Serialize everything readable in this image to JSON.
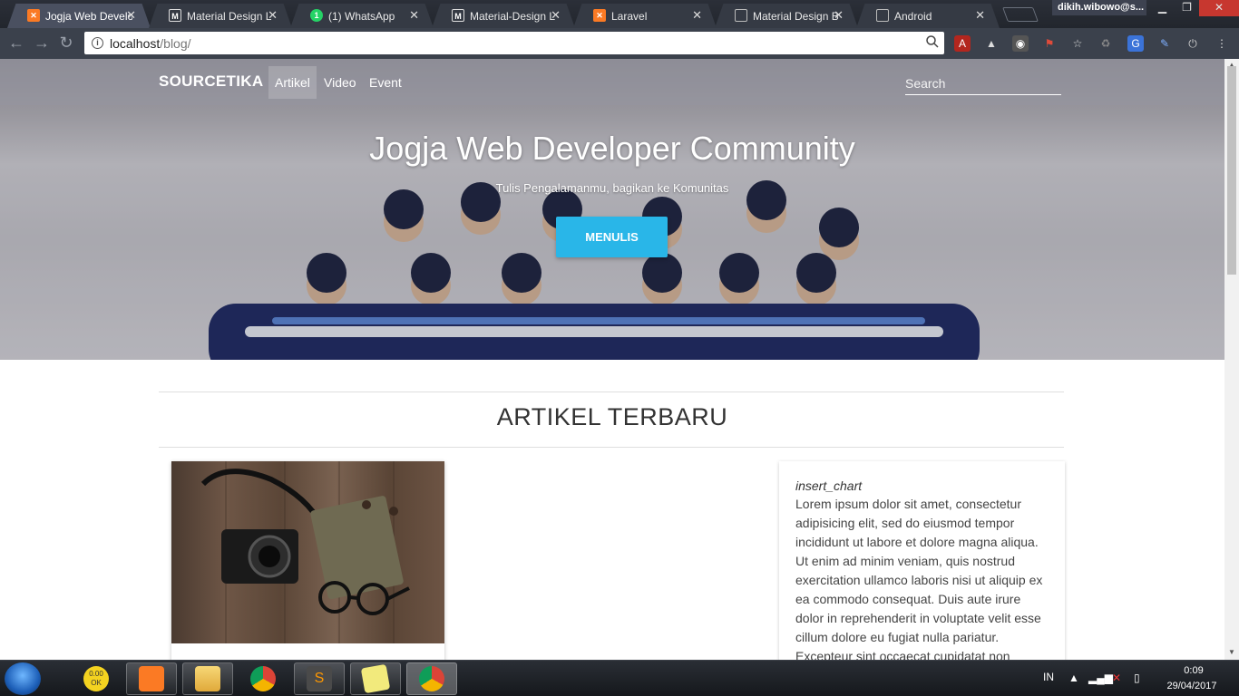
{
  "browser": {
    "tabs": [
      {
        "label": "Jogja Web Develo",
        "favicon": "xampp-icon",
        "fav_color": "#fb7a24"
      },
      {
        "label": "Material Design L",
        "favicon": "material-icon",
        "fav_color": "#3c4048"
      },
      {
        "label": "(1) WhatsApp",
        "favicon": "whatsapp-icon",
        "fav_color": "#25d366"
      },
      {
        "label": "Material-Design L",
        "favicon": "material-icon",
        "fav_color": "#3c4048"
      },
      {
        "label": "Laravel",
        "favicon": "xampp-icon",
        "fav_color": "#fb7a24"
      },
      {
        "label": "Material Design B",
        "favicon": "page-icon",
        "fav_color": "#3c4048"
      },
      {
        "label": "Android",
        "favicon": "page-icon",
        "fav_color": "#3c4048"
      }
    ],
    "profile_name": "dikih.wibowo@s...",
    "url_host": "localhost",
    "url_path": "/blog/"
  },
  "site": {
    "brand": "SOURCETIKA",
    "nav": [
      "Artikel",
      "Video",
      "Event"
    ],
    "search_placeholder": "Search",
    "hero_title": "Jogja Web Developer Community",
    "hero_subtitle": "Tulis Pengalamanmu, bagikan ke Komunitas",
    "cta_label": "MENULIS",
    "section_title": "ARTIKEL TERBARU",
    "sidebar": {
      "icon_text": "insert_chart",
      "body": "Lorem ipsum dolor sit amet, consectetur adipisicing elit, sed do eiusmod tempor incididunt ut labore et dolore magna aliqua. Ut enim ad minim veniam, quis nostrud exercitation ullamco laboris nisi ut aliquip ex ea commodo consequat. Duis aute irure dolor in reprehenderit in voluptate velit esse cillum dolore eu fugiat nulla pariatur. Excepteur sint occaecat cupidatat non"
    },
    "colors": {
      "accent": "#29b6e8"
    }
  },
  "taskbar": {
    "lang": "IN",
    "time": "0:09",
    "date": "29/04/2017",
    "badge_text": "0.00 OK"
  }
}
